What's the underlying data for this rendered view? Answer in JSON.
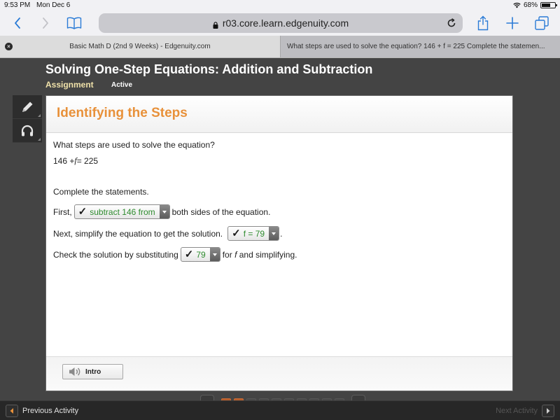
{
  "status_bar": {
    "time": "9:53 PM",
    "date": "Mon Dec 6",
    "battery_percent_label": "68%",
    "battery_level": 0.68
  },
  "browser": {
    "url": "r03.core.learn.edgenuity.com",
    "icons": {
      "back": "chevron-left-icon",
      "forward": "chevron-right-icon",
      "bookmarks": "book-icon",
      "lock": "lock-icon",
      "reload": "reload-icon",
      "share": "share-icon",
      "new_tab": "plus-icon",
      "tabs": "tabs-icon"
    },
    "tabs": [
      {
        "title": "Basic Math D (2nd 9 Weeks) - Edgenuity.com",
        "active": true
      },
      {
        "title": "What steps are used to solve the equation? 146 + f = 225 Complete the statemen...",
        "active": false
      }
    ]
  },
  "page": {
    "title": "Solving One-Step Equations: Addition and Subtraction",
    "assignment_label": "Assignment",
    "assignment_status": "Active",
    "tools": [
      {
        "name": "pencil-icon"
      },
      {
        "name": "headphones-icon"
      }
    ],
    "accent_color": "#e8913a",
    "card": {
      "title": "Identifying the Steps",
      "question": "What steps are used to solve the equation?",
      "equation_left": "146 + ",
      "equation_var": "f",
      "equation_right": " = 225",
      "instruction": "Complete the statements.",
      "statements": [
        {
          "before": "First,",
          "answer": "subtract 146 from",
          "after": "both sides of the equation.",
          "correct": true
        },
        {
          "before": "Next, simplify the equation to get the solution.",
          "answer": "f = 79",
          "after": ".",
          "correct": true
        },
        {
          "before": "Check the solution by substituting",
          "answer": "79",
          "after_pre": "for ",
          "after_var": "f",
          "after_post": " and simplifying.",
          "correct": true
        }
      ],
      "check_mark": "✓",
      "footer": {
        "intro_label": "Intro"
      }
    },
    "pager": {
      "total_dots": 10,
      "completed_dots": 2
    },
    "bottom": {
      "previous_label": "Previous Activity",
      "next_label": "Next Activity"
    }
  }
}
